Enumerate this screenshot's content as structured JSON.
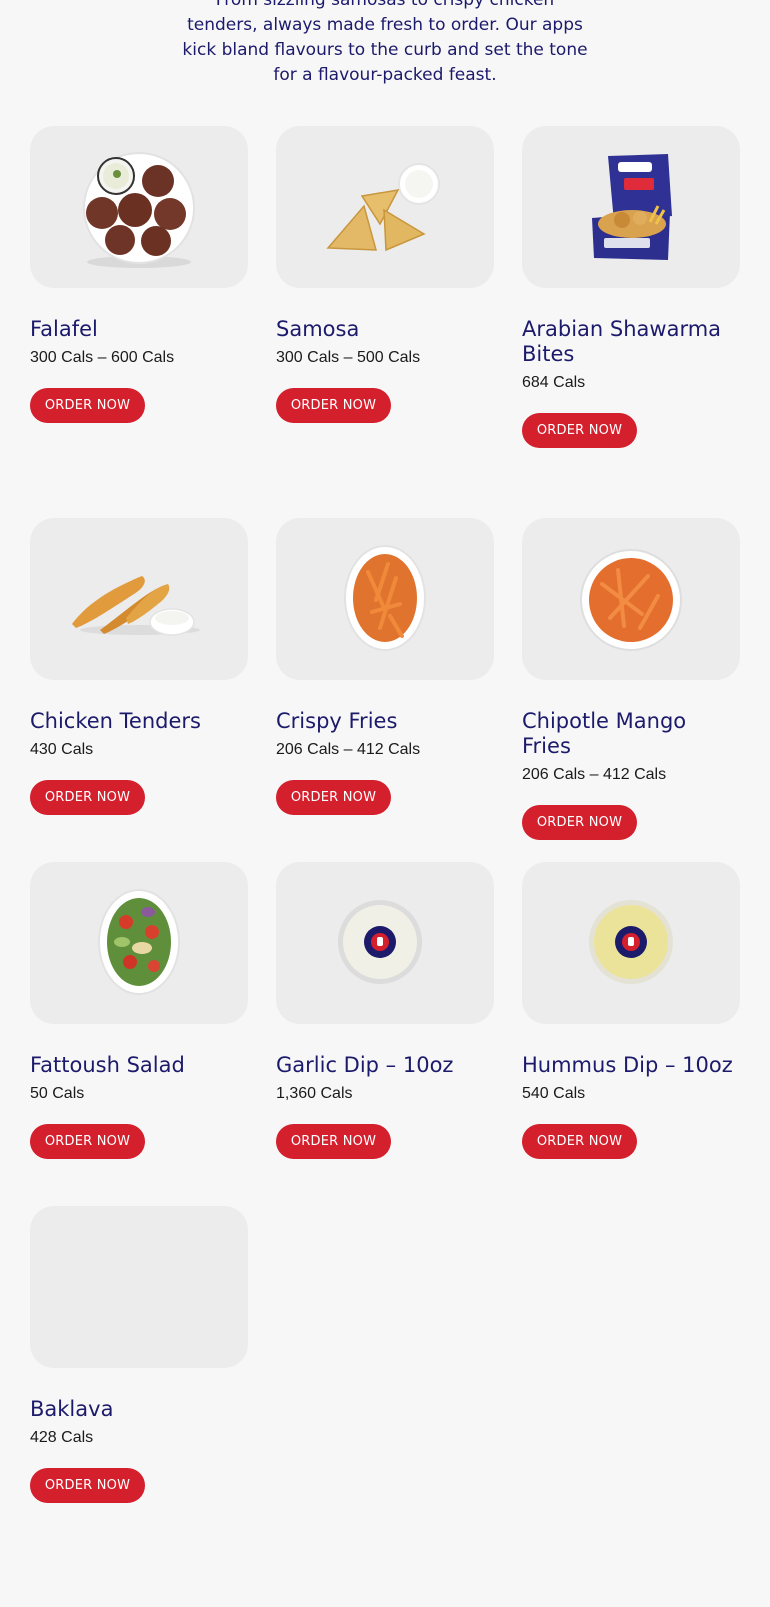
{
  "intro": {
    "text": "From sizzling samosas to crispy chicken tenders, always made fresh to order. Our apps kick bland flavours to the curb and set the tone for a flavour-packed feast."
  },
  "colors": {
    "title": "#1c1a6b",
    "button": "#d41f2d",
    "card_bg": "#ececec",
    "page_bg": "#f7f7f7"
  },
  "menu": {
    "items": [
      {
        "name": "Falafel",
        "cals": "300 Cals – 600 Cals",
        "button": "ORDER NOW",
        "image": "falafel-plate-image"
      },
      {
        "name": "Samosa",
        "cals": "300 Cals – 500 Cals",
        "button": "ORDER NOW",
        "image": "samosa-image"
      },
      {
        "name": "Arabian Shawarma Bites",
        "cals": "684 Cals",
        "button": "ORDER NOW",
        "image": "shawarma-bites-box-image"
      },
      {
        "name": "Chicken Tenders",
        "cals": "430 Cals",
        "button": "ORDER NOW",
        "image": "chicken-tenders-image"
      },
      {
        "name": "Crispy Fries",
        "cals": "206 Cals – 412 Cals",
        "button": "ORDER NOW",
        "image": "crispy-fries-image"
      },
      {
        "name": "Chipotle Mango Fries",
        "cals": "206 Cals – 412 Cals",
        "button": "ORDER NOW",
        "image": "chipotle-mango-fries-image"
      },
      {
        "name": "Fattoush Salad",
        "cals": "50 Cals",
        "button": "ORDER NOW",
        "image": "fattoush-salad-image"
      },
      {
        "name": "Garlic Dip – 10oz",
        "cals": "1,360 Cals",
        "button": "ORDER NOW",
        "image": "garlic-dip-image"
      },
      {
        "name": "Hummus Dip – 10oz",
        "cals": "540 Cals",
        "button": "ORDER NOW",
        "image": "hummus-dip-image"
      },
      {
        "name": "Baklava",
        "cals": "428 Cals",
        "button": "ORDER NOW",
        "image": ""
      }
    ]
  }
}
